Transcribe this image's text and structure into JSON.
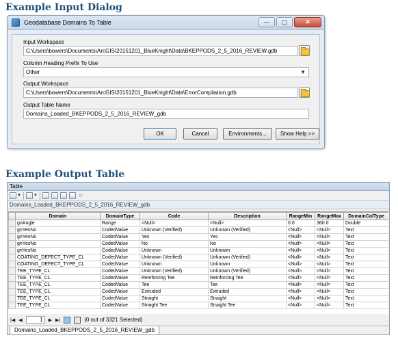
{
  "headings": {
    "input_dialog": "Example Input Dialog",
    "output_table": "Example Output Table"
  },
  "dialog": {
    "title": "Geodatabase Domains To Table",
    "input_workspace_label": "Input Workspace",
    "input_workspace_value": "C:\\Users\\bowers\\Documents\\ArcGIS\\20151201_BlueKnight\\Data\\BKEPPODS_2_5_2016_REVIEW.gdb",
    "prefix_label": "Column Heading Prefix To Use",
    "prefix_value": "Other",
    "output_workspace_label": "Output Workspace",
    "output_workspace_value": "C:\\Users\\bowers\\Documents\\ArcGIS\\20151201_BlueKnight\\Data\\ErrorCompilation.gdb",
    "output_table_label": "Output Table Name",
    "output_table_value": "Domains_Loaded_BKEPPODS_2_5_2016_REVIEW_gdb",
    "buttons": {
      "ok": "OK",
      "cancel": "Cancel",
      "environments": "Environments...",
      "show_help": "Show Help >>"
    },
    "window_buttons": {
      "minimize": "—",
      "maximize": "▢",
      "close": "✕"
    }
  },
  "table_window": {
    "title": "Table",
    "table_name": "Domains_Loaded_BKEPPODS_2_5_2016_REVIEW_gdb",
    "columns": [
      "Domain",
      "DomainType",
      "Code",
      "Description",
      "RangeMin",
      "RangeMax",
      "DomainColType"
    ],
    "rows": [
      [
        "gnAngle",
        "Range",
        "<Null>",
        "<Null>",
        "0.0",
        "360.0",
        "Double"
      ],
      [
        "gnYesNo",
        "CodedValue",
        "Unknown (Verified)",
        "Unknown (Verified)",
        "<Null>",
        "<Null>",
        "Text"
      ],
      [
        "gnYesNo",
        "CodedValue",
        "Yes",
        "Yes",
        "<Null>",
        "<Null>",
        "Text"
      ],
      [
        "gnYesNo",
        "CodedValue",
        "No",
        "No",
        "<Null>",
        "<Null>",
        "Text"
      ],
      [
        "gnYesNo",
        "CodedValue",
        "Unknown",
        "Unknown",
        "<Null>",
        "<Null>",
        "Text"
      ],
      [
        "COATING_DEFECT_TYPE_CL",
        "CodedValue",
        "Unknown (Verified)",
        "Unknown (Verified)",
        "<Null>",
        "<Null>",
        "Text"
      ],
      [
        "COATING_DEFECT_TYPE_CL",
        "CodedValue",
        "Unknown",
        "Unknown",
        "<Null>",
        "<Null>",
        "Text"
      ],
      [
        "TEE_TYPE_CL",
        "CodedValue",
        "Unknown (Verified)",
        "Unknown (Verified)",
        "<Null>",
        "<Null>",
        "Text"
      ],
      [
        "TEE_TYPE_CL",
        "CodedValue",
        "Reinforcing Tee",
        "Reinforcing Tee",
        "<Null>",
        "<Null>",
        "Text"
      ],
      [
        "TEE_TYPE_CL",
        "CodedValue",
        "Tee",
        "Tee",
        "<Null>",
        "<Null>",
        "Text"
      ],
      [
        "TEE_TYPE_CL",
        "CodedValue",
        "Extruded",
        "Extruded",
        "<Null>",
        "<Null>",
        "Text"
      ],
      [
        "TEE_TYPE_CL",
        "CodedValue",
        "Straight",
        "Straight",
        "<Null>",
        "<Null>",
        "Text"
      ],
      [
        "TEE_TYPE_CL",
        "CodedValue",
        "Straight Tee",
        "Straight Tee",
        "<Null>",
        "<Null>",
        "Text"
      ]
    ],
    "nav": {
      "page": "1",
      "selection_status": "(0 out of 3321 Selected)"
    },
    "bottom_tab": "Domains_Loaded_BKEPPODS_2_5_2016_REVIEW_gdb"
  }
}
